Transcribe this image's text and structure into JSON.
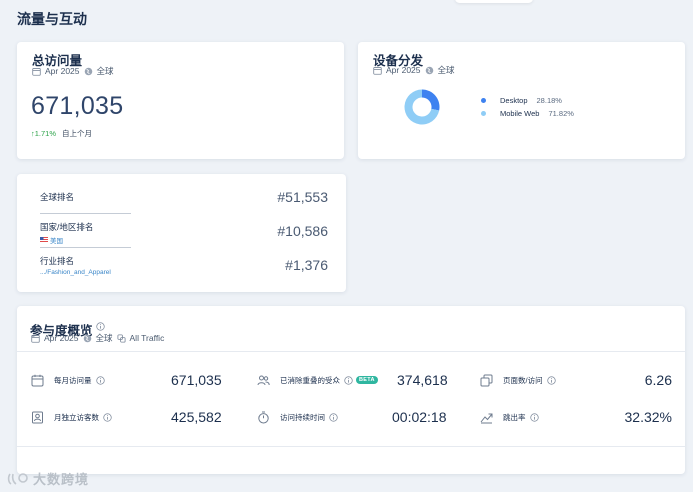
{
  "page": {
    "title": "流量与互动"
  },
  "visits": {
    "title": "总访问量",
    "period": "Apr 2025",
    "region": "全球",
    "total": "671,035",
    "change": "↑1.71%",
    "change_compare": "自上个月"
  },
  "device": {
    "title": "设备分发",
    "period": "Apr 2025",
    "region": "全球",
    "chart_data": {
      "type": "pie",
      "categories": [
        "Desktop",
        "Mobile Web"
      ],
      "values": [
        28.18,
        71.82
      ],
      "colors": [
        "#3e82f0",
        "#8fcdf6"
      ]
    },
    "items": [
      {
        "name": "Desktop",
        "value": "28.18%",
        "color": "#3e82f0"
      },
      {
        "name": "Mobile Web",
        "value": "71.82%",
        "color": "#8fcdf6"
      }
    ]
  },
  "ranks": {
    "global": {
      "label": "全球排名",
      "value": "#51,553"
    },
    "country": {
      "label": "国家/地区排名",
      "sub": "美国",
      "value": "#10,586"
    },
    "industry": {
      "label": "行业排名",
      "sub": ".../Fashion_and_Apparel",
      "value": "#1,376"
    }
  },
  "engagement": {
    "title": "参与度概览",
    "period": "Apr 2025",
    "region": "全球",
    "traffic": "All Traffic",
    "metrics": {
      "monthly_visits": {
        "label": "每月访问量",
        "value": "671,035",
        "icon": "calendar-icon"
      },
      "dedup_audience": {
        "label": "已消除重叠的受众",
        "badge": "BETA",
        "value": "374,618",
        "icon": "users-icon"
      },
      "pages_per_visit": {
        "label": "页面数/访问",
        "value": "6.26",
        "icon": "pages-icon"
      },
      "unique_visitors": {
        "label": "月独立访客数",
        "value": "425,582",
        "icon": "id-badge-icon"
      },
      "visit_duration": {
        "label": "访问持续时间",
        "value": "00:02:18",
        "icon": "stopwatch-icon"
      },
      "bounce_rate": {
        "label": "跳出率",
        "value": "32.32%",
        "icon": "bounce-arrow-icon"
      }
    }
  },
  "watermark": {
    "text": "大数跨境"
  }
}
